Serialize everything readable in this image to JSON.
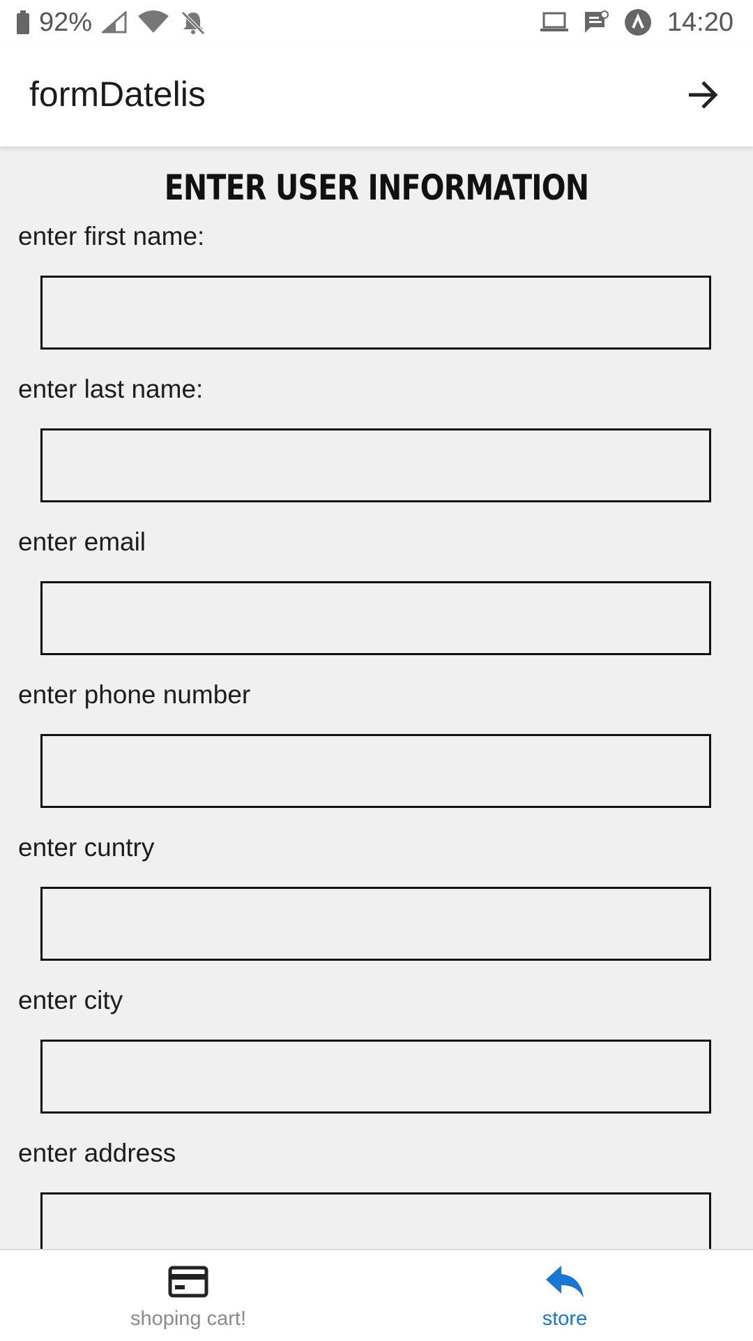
{
  "status_bar": {
    "battery": "92%",
    "time": "14:20",
    "icons": [
      "battery-icon",
      "cell-signal-icon",
      "wifi-icon",
      "notifications-off-icon",
      "laptop-icon",
      "message-icon",
      "app-a-icon"
    ]
  },
  "app_bar": {
    "title": "formDatelis",
    "forward_icon": "arrow-forward-icon"
  },
  "form": {
    "heading": "ENTER USER INFORMATION",
    "fields": [
      {
        "label": "enter first name:",
        "value": ""
      },
      {
        "label": "enter last name:",
        "value": ""
      },
      {
        "label": "enter email",
        "value": ""
      },
      {
        "label": "enter phone number",
        "value": ""
      },
      {
        "label": "enter cuntry",
        "value": ""
      },
      {
        "label": "enter city",
        "value": ""
      },
      {
        "label": "enter address",
        "value": ""
      }
    ]
  },
  "bottom_nav": {
    "items": [
      {
        "label": "shoping cart!",
        "icon": "credit-card-icon",
        "active": false
      },
      {
        "label": "store",
        "icon": "reply-icon",
        "active": true
      }
    ]
  },
  "colors": {
    "active_tab": "#1976d2",
    "inactive_tab": "#8a8a8a",
    "background": "#f0f0f0"
  }
}
